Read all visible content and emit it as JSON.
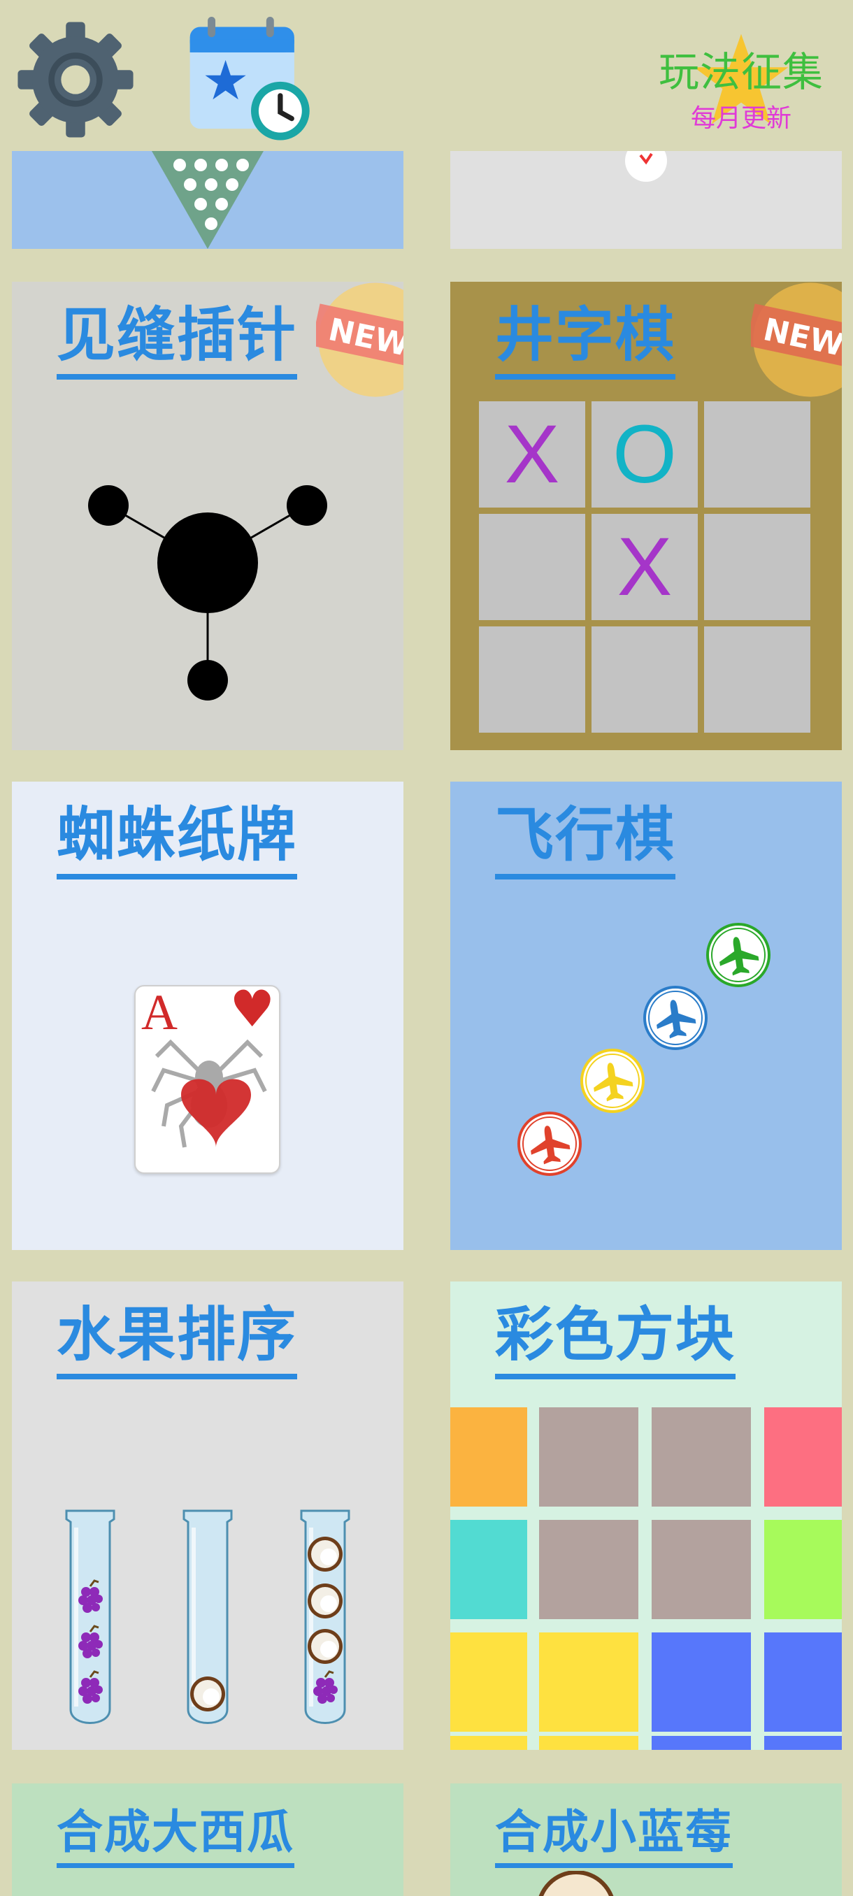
{
  "header": {
    "settings_icon": "gear-icon",
    "calendar_icon": "calendar-clock-icon",
    "promo": {
      "title": "玩法征集",
      "subtitle": "每月更新",
      "icon": "star-icon"
    }
  },
  "badge_text": "NEW!",
  "games": {
    "pin": {
      "title": "见缝插针",
      "is_new": true
    },
    "tictactoe": {
      "title": "井字棋",
      "is_new": true,
      "board": [
        "X",
        "O",
        "",
        "",
        "X",
        "",
        "",
        "",
        ""
      ]
    },
    "spider": {
      "title": "蜘蛛纸牌",
      "card_rank": "A",
      "card_suit": "♥"
    },
    "ludo": {
      "title": "飞行棋",
      "plane_colors": [
        "#2aa82a",
        "#2a7cc9",
        "#f4d21f",
        "#e0422c"
      ]
    },
    "fruit": {
      "title": "水果排序"
    },
    "colorblocks": {
      "title": "彩色方块",
      "colors": [
        "#fbb340",
        "#b3a29e",
        "#b3a29e",
        "#fd6f81",
        "#52dbd2",
        "#b3a29e",
        "#b3a29e",
        "#a7fa5b",
        "#fee140",
        "#fee140",
        "#5777fb",
        "#5777fb"
      ]
    },
    "watermelon": {
      "title": "合成大西瓜"
    },
    "blueberry": {
      "title": "合成小蓝莓"
    }
  },
  "colors": {
    "background": "#d9d9b7",
    "title_blue": "#2a8ae0",
    "x_mark": "#a535c9",
    "o_mark": "#12b3c6"
  }
}
